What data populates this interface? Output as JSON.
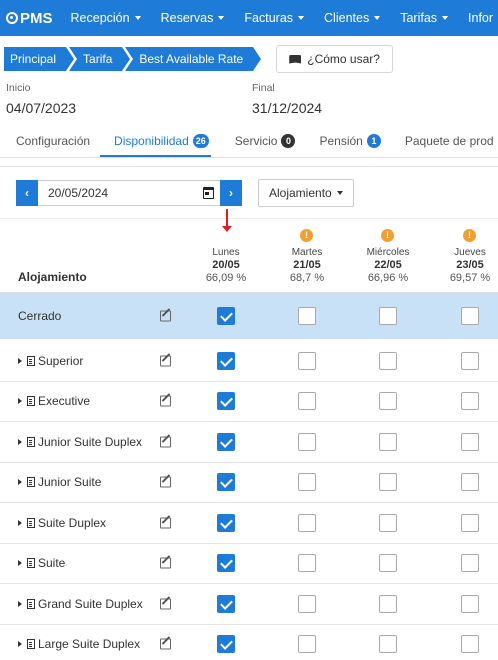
{
  "app": {
    "logo": "PMS"
  },
  "nav": [
    "Recepción",
    "Reservas",
    "Facturas",
    "Clientes",
    "Tarifas",
    "Infor"
  ],
  "breadcrumb": [
    "Principal",
    "Tarifa",
    "Best Available Rate"
  ],
  "how_to": "¿Cómo usar?",
  "dates": {
    "start_label": "Inicio",
    "start_value": "04/07/2023",
    "end_label": "Final",
    "end_value": "31/12/2024"
  },
  "tabs": [
    {
      "label": "Configuración",
      "badge": ""
    },
    {
      "label": "Disponibilidad",
      "badge": "26"
    },
    {
      "label": "Servicio",
      "badge": "0"
    },
    {
      "label": "Pensión",
      "badge": "1"
    },
    {
      "label": "Paquete de prod",
      "badge": ""
    }
  ],
  "controls": {
    "date": "20/05/2024",
    "accommodation_select": "Alojamiento"
  },
  "grid": {
    "column_title": "Alojamiento",
    "days": [
      {
        "name": "Lunes",
        "date": "20/05",
        "pct": "66,09 %",
        "warning": false
      },
      {
        "name": "Martes",
        "date": "21/05",
        "pct": "68,7 %",
        "warning": true
      },
      {
        "name": "Miércoles",
        "date": "22/05",
        "pct": "66,96 %",
        "warning": true
      },
      {
        "name": "Jueves",
        "date": "23/05",
        "pct": "69,57 %",
        "warning": true
      }
    ],
    "warning_glyph": "!",
    "rows": [
      {
        "label": "Cerrado",
        "checks": [
          true,
          false,
          false,
          false
        ]
      },
      {
        "label": "Superior",
        "checks": [
          true,
          false,
          false,
          false
        ]
      },
      {
        "label": "Executive",
        "checks": [
          true,
          false,
          false,
          false
        ]
      },
      {
        "label": "Junior Suite Duplex",
        "checks": [
          true,
          false,
          false,
          false
        ]
      },
      {
        "label": "Junior Suite",
        "checks": [
          true,
          false,
          false,
          false
        ]
      },
      {
        "label": "Suite Duplex",
        "checks": [
          true,
          false,
          false,
          false
        ]
      },
      {
        "label": "Suite",
        "checks": [
          true,
          false,
          false,
          false
        ]
      },
      {
        "label": "Grand Suite Duplex",
        "checks": [
          true,
          false,
          false,
          false
        ]
      },
      {
        "label": "Large Suite Duplex",
        "checks": [
          true,
          false,
          false,
          false
        ]
      }
    ]
  },
  "colors": {
    "primary": "#1f7bd8",
    "closed_row_bg": "#c9e1f7",
    "warning": "#f0a030",
    "annotation_arrow": "#e02020"
  }
}
